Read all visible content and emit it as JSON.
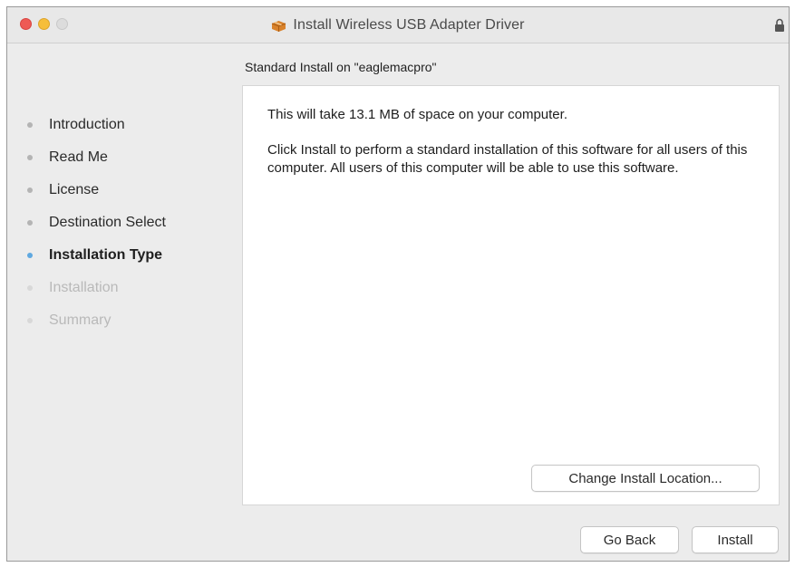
{
  "window": {
    "title": "Install Wireless USB Adapter Driver"
  },
  "steps": [
    {
      "label": "Introduction",
      "state": "done"
    },
    {
      "label": "Read Me",
      "state": "done"
    },
    {
      "label": "License",
      "state": "done"
    },
    {
      "label": "Destination Select",
      "state": "done"
    },
    {
      "label": "Installation Type",
      "state": "active"
    },
    {
      "label": "Installation",
      "state": "future"
    },
    {
      "label": "Summary",
      "state": "future"
    }
  ],
  "main": {
    "heading": "Standard Install on \"eaglemacpro\"",
    "paragraph1": "This will take 13.1 MB of space on your computer.",
    "paragraph2": "Click Install to perform a standard installation of this software for all users of this computer. All users of this computer will be able to use this software.",
    "change_location_label": "Change Install Location..."
  },
  "footer": {
    "back_label": "Go Back",
    "install_label": "Install"
  },
  "colors": {
    "active_dot": "#5fa8e0",
    "close": "#ee5a55",
    "minimize": "#f6be3a"
  },
  "icons": {
    "title": "installer-package-icon",
    "lock": "lock-icon"
  }
}
